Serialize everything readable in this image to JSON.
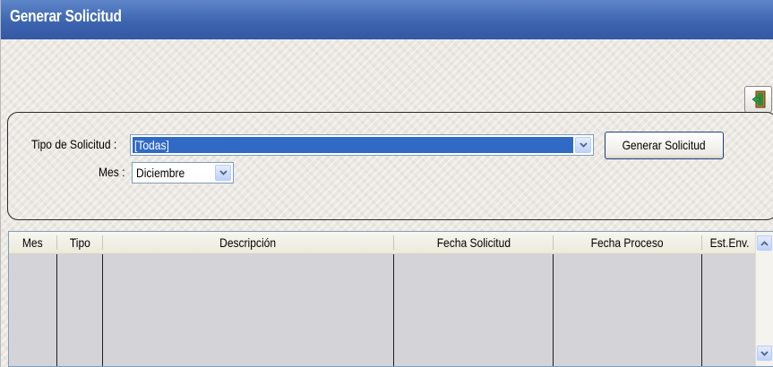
{
  "window": {
    "title": "Generar Solicitud"
  },
  "toolbar": {
    "exit_icon": "exit-door-icon"
  },
  "form": {
    "tipo_label": "Tipo de Solicitud :",
    "tipo_value": "[Todas]",
    "mes_label": "Mes :",
    "mes_value": "Diciembre",
    "generar_label": "Generar Solicitud"
  },
  "grid": {
    "columns": [
      "Mes",
      "Tipo",
      "Descripción",
      "Fecha Solicitud",
      "Fecha Proceso",
      "Est.Env."
    ],
    "rows": []
  },
  "colors": {
    "titlebar": "#3d65b0",
    "selection": "#316ac5",
    "grid_body": "#d4d3d8"
  }
}
